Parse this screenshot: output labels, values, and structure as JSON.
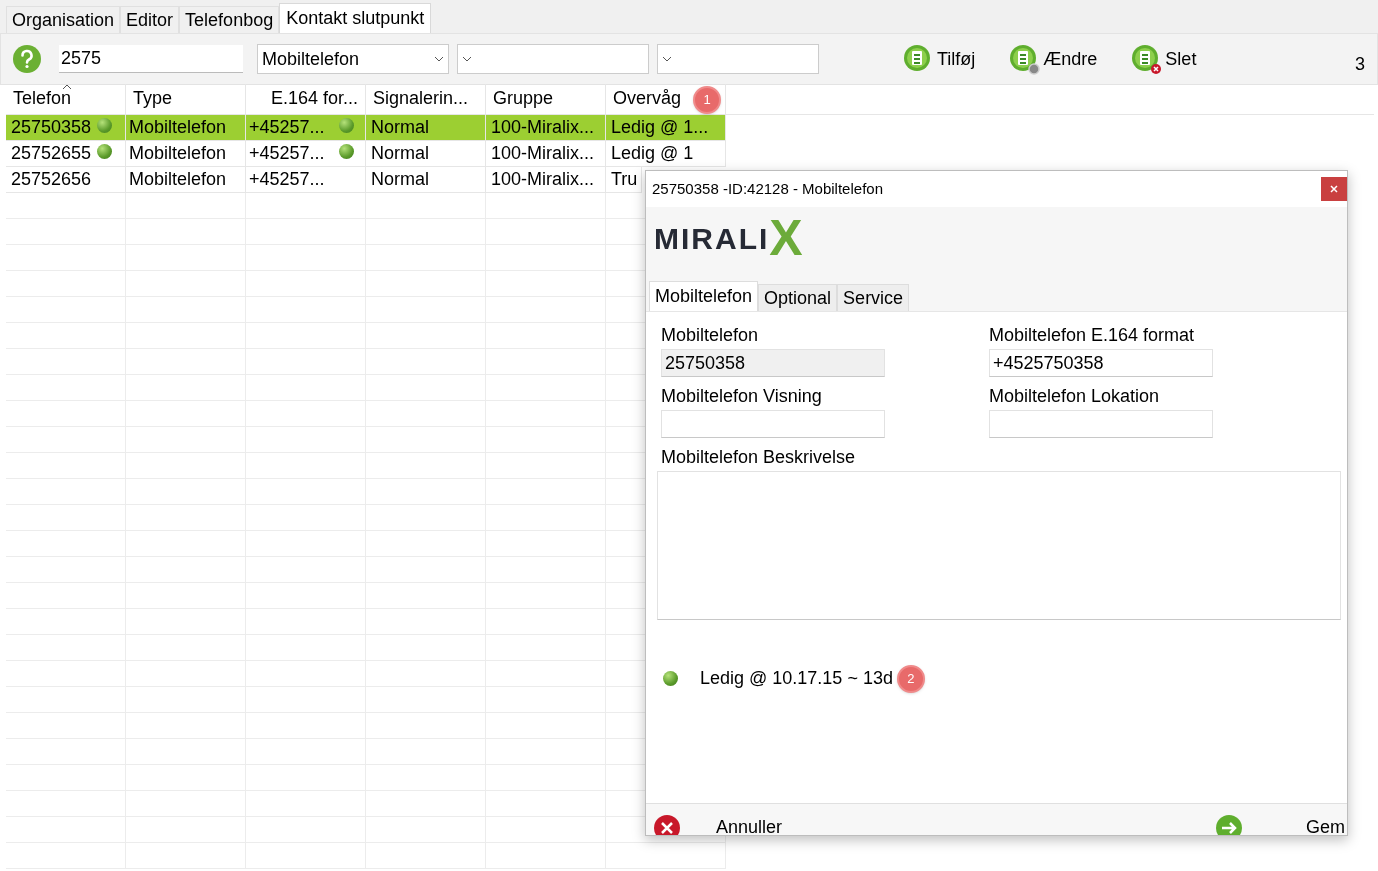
{
  "tabs": [
    {
      "label": "Organisation",
      "selected": false
    },
    {
      "label": "Editor",
      "selected": false
    },
    {
      "label": "Telefonbog",
      "selected": false
    },
    {
      "label": "Kontakt slutpunkt",
      "selected": true
    }
  ],
  "toolbar": {
    "search": {
      "value": "2575"
    },
    "type_filter": {
      "value": "Mobiltelefon"
    },
    "actions": [
      {
        "kind": "add",
        "label": "Tilføj"
      },
      {
        "kind": "edit",
        "label": "Ændre"
      },
      {
        "kind": "delete",
        "label": "Slet"
      }
    ],
    "count": "3"
  },
  "table": {
    "columns": [
      {
        "label": "Telefon",
        "sorted": true
      },
      {
        "label": "Type",
        "sorted": false
      },
      {
        "label": "E.164 for...",
        "sorted": false
      },
      {
        "label": "Signalerin...",
        "sorted": false
      },
      {
        "label": "Gruppe",
        "sorted": false
      },
      {
        "label": "Overvåg",
        "sorted": false
      }
    ],
    "header_badge": "1",
    "rows": [
      {
        "selected": true,
        "phone_dot": true,
        "e164_dot": true,
        "cells": [
          "25750358",
          "Mobiltelefon",
          "+45257...",
          "Normal",
          "100-Miralix...",
          "Ledig @ 1..."
        ]
      },
      {
        "selected": false,
        "phone_dot": true,
        "e164_dot": true,
        "cells": [
          "25752655",
          "Mobiltelefon",
          "+45257...",
          "Normal",
          "100-Miralix...",
          "Ledig @ 1"
        ]
      },
      {
        "selected": false,
        "phone_dot": false,
        "e164_dot": false,
        "cells": [
          "25752656",
          "Mobiltelefon",
          "+45257...",
          "Normal",
          "100-Miralix...",
          "Tru"
        ]
      }
    ]
  },
  "dialog": {
    "title": "25750358 -ID:42128 - Mobiltelefon",
    "logo": "MIRALIX",
    "tabs": [
      {
        "label": "Mobiltelefon",
        "selected": true
      },
      {
        "label": "Optional",
        "selected": false
      },
      {
        "label": "Service",
        "selected": false
      }
    ],
    "fields": [
      {
        "label": "Mobiltelefon",
        "value": "25750358",
        "disabled": true
      },
      {
        "label": "Mobiltelefon E.164 format",
        "value": "+4525750358",
        "disabled": false
      },
      {
        "label": "Mobiltelefon Visning",
        "disabled": false
      },
      {
        "label": "Mobiltelefon Lokation",
        "disabled": false
      }
    ],
    "description": {
      "label": "Mobiltelefon Beskrivelse"
    },
    "status": {
      "text": "Ledig @ 10.17.15 ~ 13d",
      "badge": "2"
    },
    "buttons": [
      {
        "kind": "cancel",
        "label": "Annuller"
      },
      {
        "kind": "save",
        "label": "Gem"
      }
    ]
  }
}
